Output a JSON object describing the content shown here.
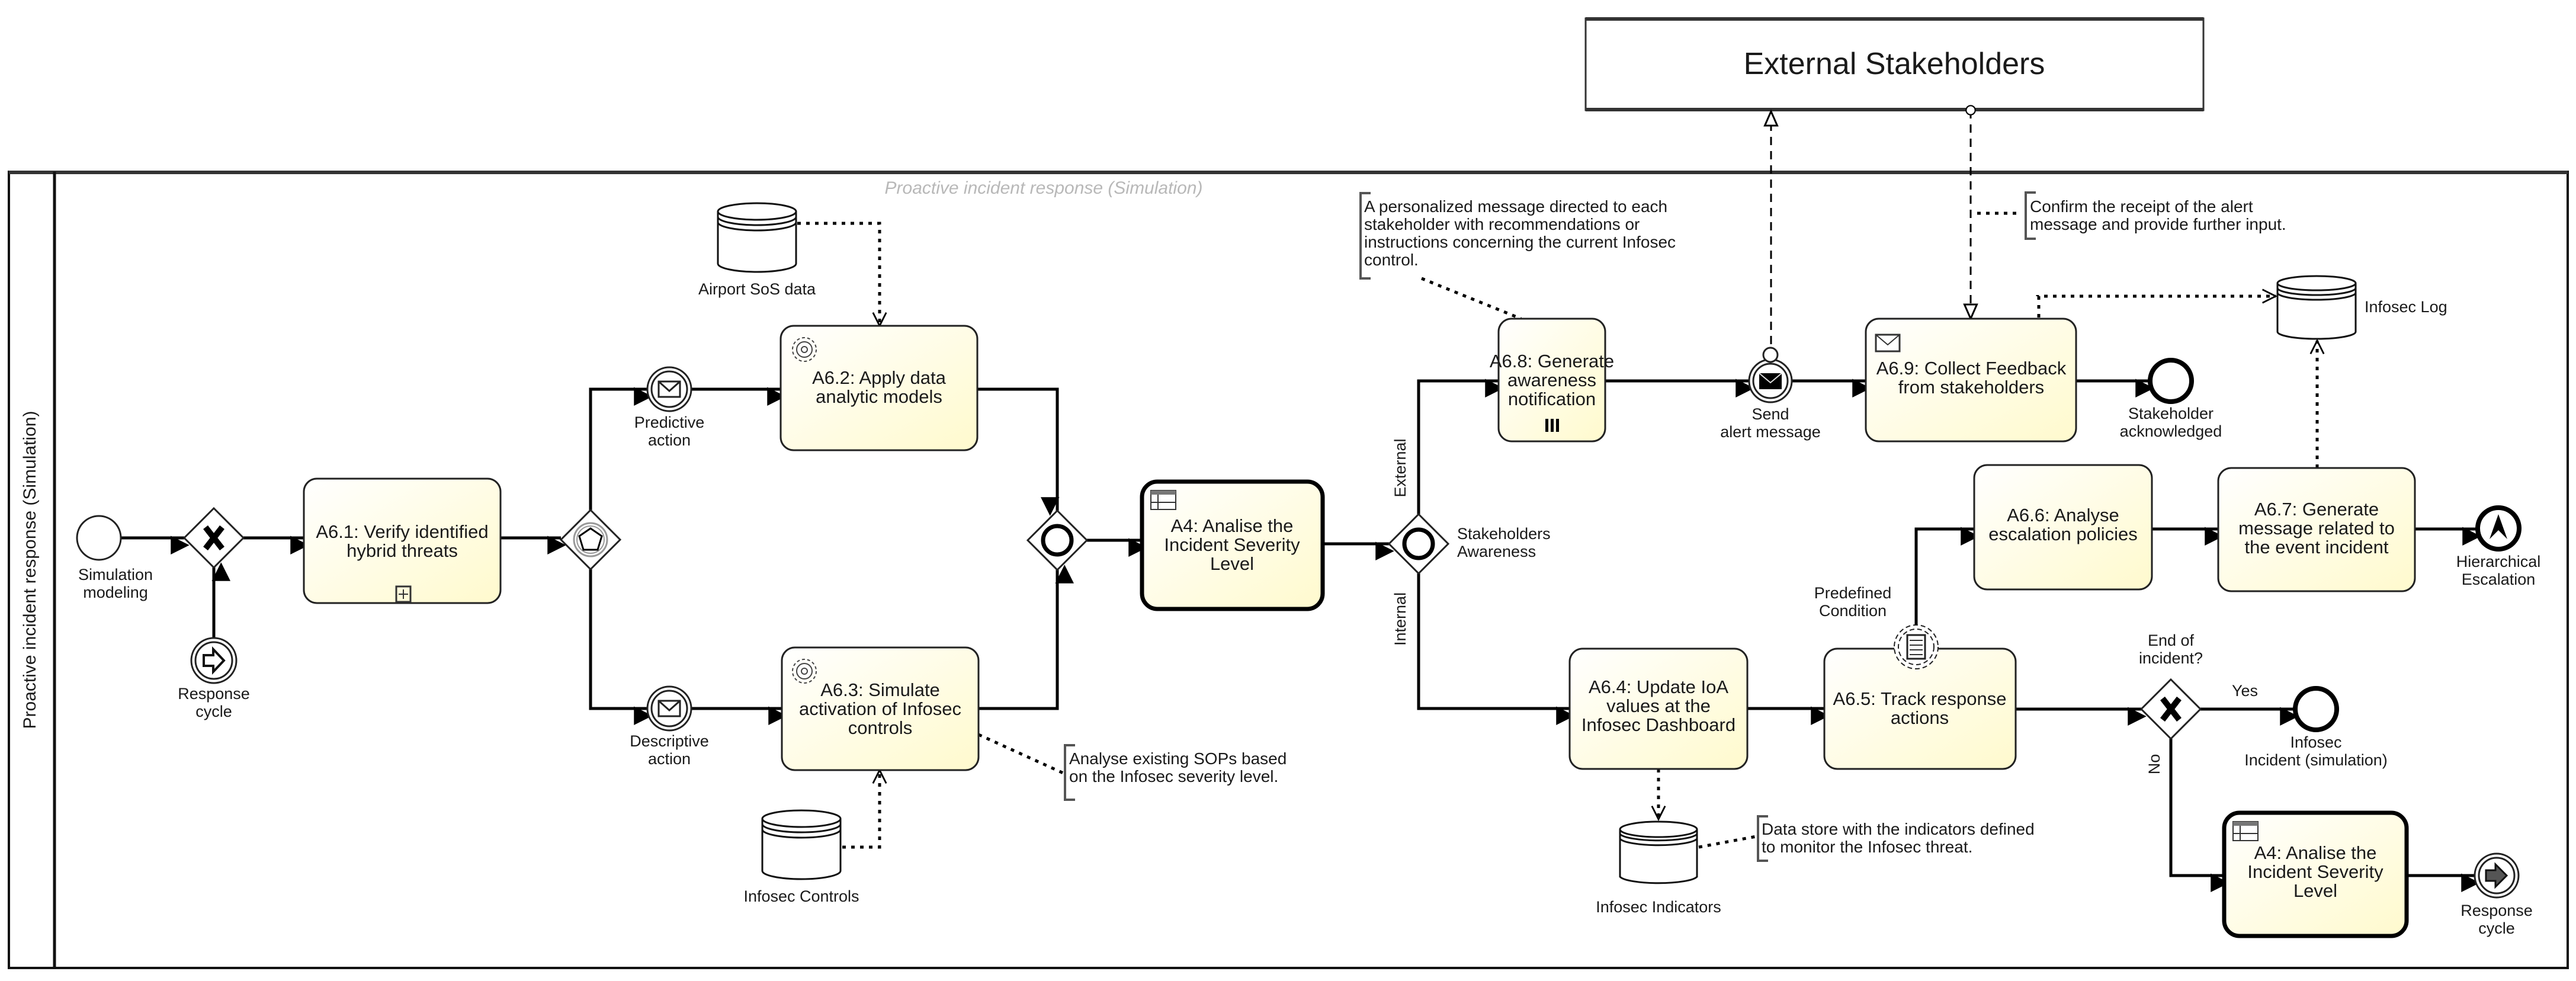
{
  "diagram": {
    "type": "BPMN process diagram",
    "pool": {
      "name": "Proactive incident response (Simulation)",
      "lane_title": "Proactive incident response (Simulation)"
    },
    "external_pool": {
      "name": "External Stakeholders"
    },
    "events": {
      "simulation_modeling": "Simulation modeling",
      "response_cycle_start": "Response cycle",
      "predictive_action": "Predictive action",
      "descriptive_action": "Descriptive action",
      "send_alert": "Send alert message",
      "stakeholder_ack": "Stakeholder acknowledged",
      "hierarchical_escalation": "Hierarchical Escalation",
      "predefined_condition": "Predefined Condition",
      "infosec_incident": "Infosec Incident (simulation)",
      "response_cycle_end": "Response cycle"
    },
    "tasks": {
      "a61": "A6.1: Verify identified hybrid threats",
      "a62": "A6.2: Apply data analytic models",
      "a63": "A6.3: Simulate activation of Infosec controls",
      "a4": "A4: Analise the Incident Severity Level",
      "a68": "A6.8: Generate awareness notification",
      "a69": "A6.9: Collect Feedback from stakeholders",
      "a66": "A6.6: Analyse escalation policies",
      "a67": "A6.7: Generate message related to the event incident",
      "a64": "A6.4: Update IoA values at the Infosec Dashboard",
      "a65": "A6.5: Track response actions",
      "a4b": "A4: Analise the Incident Severity Level"
    },
    "gateways": {
      "stakeholders": "Stakeholders Awareness",
      "end_of_incident": "End of incident?"
    },
    "flow_labels": {
      "external": "External",
      "internal": "Internal",
      "yes": "Yes",
      "no": "No"
    },
    "data_stores": {
      "airport_sos": "Airport SoS data",
      "infosec_controls": "Infosec Controls",
      "infosec_log": "Infosec Log",
      "infosec_indicators": "Infosec Indicators"
    },
    "annotations": {
      "sops": [
        "Analyse existing SOPs based",
        "on the Infosec severity level."
      ],
      "personalized": [
        "A personalized message directed to each",
        "stakeholder with recommendations or",
        "instructions concerning the current Infosec",
        "control."
      ],
      "confirm": [
        "Confirm the receipt of the alert",
        "message and provide further input."
      ],
      "indicators": [
        "Data store with the indicators defined",
        "to monitor the Infosec threat."
      ]
    },
    "colors": {
      "task_fill_start": "#ffffff",
      "task_fill_end": "#fffacd",
      "line": "#000000",
      "lane_title": "#b8b8b8",
      "annotation_bracket": "#555555"
    }
  }
}
